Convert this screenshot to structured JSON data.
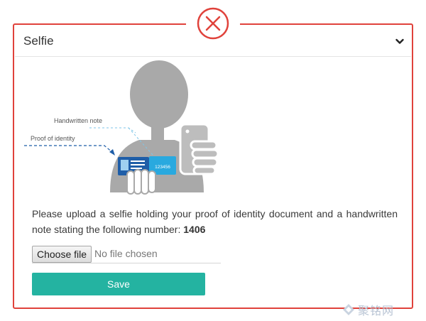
{
  "colors": {
    "frame_border": "#e0423b",
    "accent_teal": "#24b3a1",
    "figure_gray": "#a9a9a9",
    "card_blue": "#29a9df",
    "card_dark_blue": "#1f5ea8"
  },
  "close_badge": {
    "icon": "close-circle-icon"
  },
  "panel": {
    "title": "Selfie",
    "toggle_icon": "chevron-down-icon"
  },
  "illustration": {
    "label_handwritten": "Handwritten note",
    "label_proof": "Proof of identity",
    "note_number": "123456"
  },
  "instructions": {
    "text": "Please upload a selfie holding your proof of identity document and a handwritten note stating the following number: ",
    "number": "1406"
  },
  "file_input": {
    "button_label": "Choose file",
    "status": "No file chosen"
  },
  "save_label": "Save",
  "watermark": {
    "text": "聚铭网",
    "icon": "watermark-logo-icon"
  }
}
